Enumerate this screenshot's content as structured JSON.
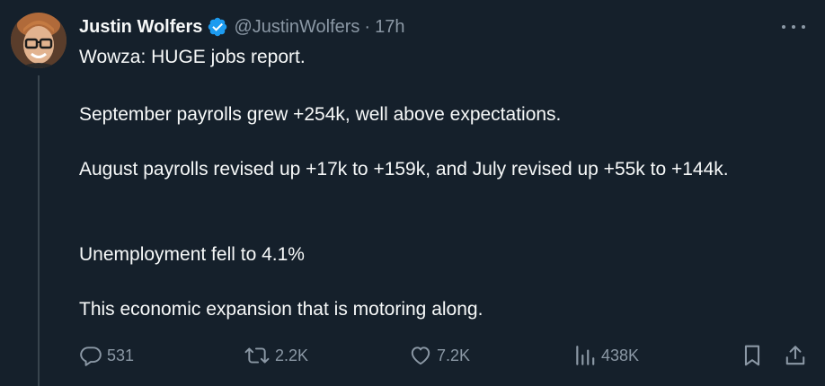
{
  "author": {
    "display_name": "Justin Wolfers",
    "handle": "@JustinWolfers",
    "separator": "·",
    "time_ago": "17h",
    "verified": true,
    "avatar_icon": "profile-photo"
  },
  "tweet": {
    "paragraphs": [
      "Wowza: HUGE jobs report.",
      "September payrolls grew +254k, well above expectations.",
      "August payrolls revised up +17k to +159k, and July revised up +55k to +144k.",
      "Unemployment fell to 4.1%",
      "This economic expansion that is motoring along."
    ]
  },
  "actions": {
    "reply_count": "531",
    "retweet_count": "2.2K",
    "like_count": "7.2K",
    "views_count": "438K"
  },
  "colors": {
    "background": "#15202b",
    "text_primary": "#f7f9f9",
    "text_secondary": "#8b98a5",
    "verified_badge": "#1d9bf0",
    "thread_line": "#38444d"
  }
}
